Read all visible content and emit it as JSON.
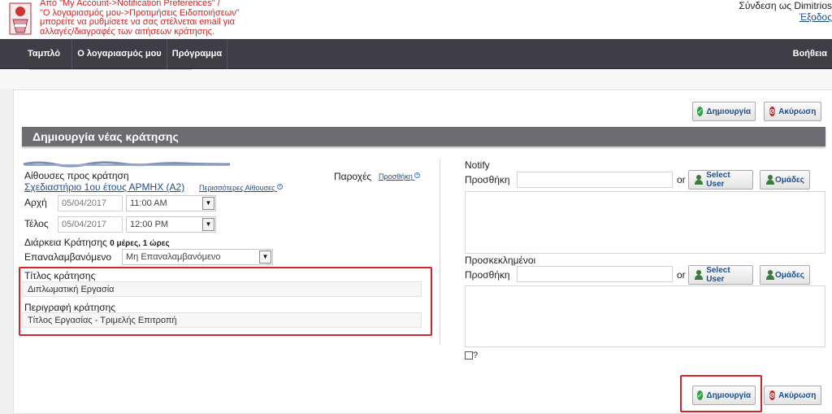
{
  "header": {
    "notice_lines": [
      "Από \"My Account->Notification Preferences\" /",
      "\"Ο λογαριασμός μου->Προτιμήσεις Ειδοποιήσεων\"",
      "μπορείτε να ρυθμίσετε να σας στέλνεται email για",
      "αλλαγές/διαγραφές των αιτήσεων κράτησης."
    ],
    "login_text": "Σύνδεση ως Dimitrios",
    "logout_label": "Έξοδος"
  },
  "nav": {
    "items": [
      "Ταμπλό",
      "Ο λογαριασμός μου",
      "Πρόγραμμα"
    ],
    "help": "Βοήθεια"
  },
  "toolbar": {
    "create_label": "Δημιουργία",
    "cancel_label": "Ακύρωση"
  },
  "section_title": "Δημιουργία νέας κράτησης",
  "form": {
    "resources_label": "Αίθουσες προς κράτηση",
    "resource_name": "Σχεδιαστήριο 1ου έτους ΑΡΜΗΧ (Α2)",
    "more_resources": "Περισσότερες Αίθουσες",
    "accessories_label": "Παροχές",
    "add_label": "Προσθήκη",
    "start_label": "Αρχή",
    "start_date": "05/04/2017",
    "start_time": "11:00 AM",
    "end_label": "Τέλος",
    "end_date": "05/04/2017",
    "end_time": "12:00 PM",
    "duration_label": "Διάρκεια Κράτησης",
    "duration_value": "0 μέρες, 1 ώρες",
    "repeat_label": "Επαναλαμβανόμενο",
    "repeat_value": "Μη Επαναλαμβανόμενο",
    "title_label": "Τίτλος κράτησης",
    "title_value": "Διπλωματική Εργασία",
    "description_label": "Περιγραφή κράτησης",
    "description_value": "Τίτλος Εργασίας - Τριμελής Επιτροπή"
  },
  "right": {
    "notify_label": "Notify",
    "add_label": "Προσθήκη",
    "or_label": "or",
    "select_user_label": "Select User",
    "groups_label": "Ομάδες",
    "invitees_label": "Προσκεκλημένοι",
    "question_label": "?"
  },
  "colors": {
    "navbar": "#3e3e44",
    "section_bar": "#6c6c72",
    "link": "#1f4d8a",
    "highlight": "#d4252a",
    "notice": "#d71f1f"
  }
}
